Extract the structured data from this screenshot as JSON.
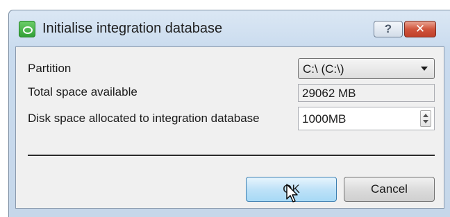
{
  "dialog": {
    "title": "Initialise integration database",
    "help_label": "?",
    "close_label": "✕"
  },
  "form": {
    "partition": {
      "label": "Partition",
      "value": "C:\\ (C:\\)"
    },
    "total_space": {
      "label": "Total space available",
      "value": "29062 MB"
    },
    "allocated_space": {
      "label": "Disk space allocated to integration database",
      "value": "1000MB"
    }
  },
  "buttons": {
    "ok_label": "OK",
    "cancel_label": "Cancel"
  },
  "colors": {
    "title_bar": "#c9dbee",
    "close_button": "#c9503a",
    "ok_button": "#bfe2f8",
    "app_icon": "#3fae3f"
  },
  "icons": {
    "app": "app-logo-icon",
    "help": "help-icon",
    "close": "close-icon",
    "dropdown": "chevron-down-icon",
    "cursor": "mouse-cursor-icon"
  }
}
